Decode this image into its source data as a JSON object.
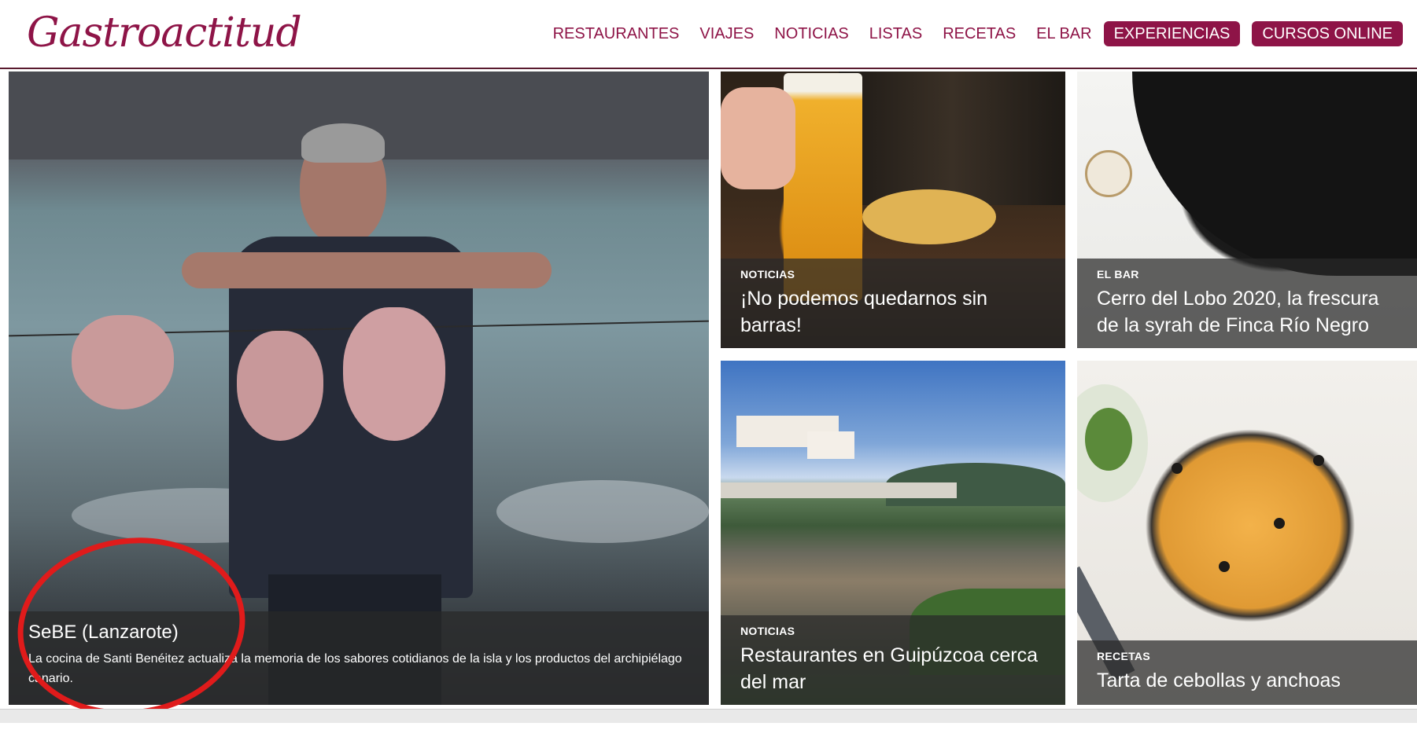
{
  "header": {
    "logo": "Gastroactitud",
    "nav": [
      "RESTAURANTES",
      "VIAJES",
      "NOTICIAS",
      "LISTAS",
      "RECETAS",
      "EL BAR"
    ],
    "buttons": [
      "EXPERIENCIAS",
      "CURSOS ONLINE"
    ],
    "brand_color": "#8e1447"
  },
  "featured": {
    "title": "SeBE (Lanzarote)",
    "excerpt": "La cocina de Santi Benéitez actualiza la memoria de los sabores cotidianos de la isla y los productos del archipiélago canario."
  },
  "cards": [
    {
      "category": "NOTICIAS",
      "title": "¡No podemos quedarnos sin barras!"
    },
    {
      "category": "EL BAR",
      "title": "Cerro del Lobo 2020, la frescura de la syrah de Finca Río Negro"
    },
    {
      "category": "NOTICIAS",
      "title": "Restaurantes en Guipúzcoa cerca del mar"
    },
    {
      "category": "RECETAS",
      "title": "Tarta de cebollas y anchoas"
    }
  ],
  "annotation_color": "#e01b1b"
}
